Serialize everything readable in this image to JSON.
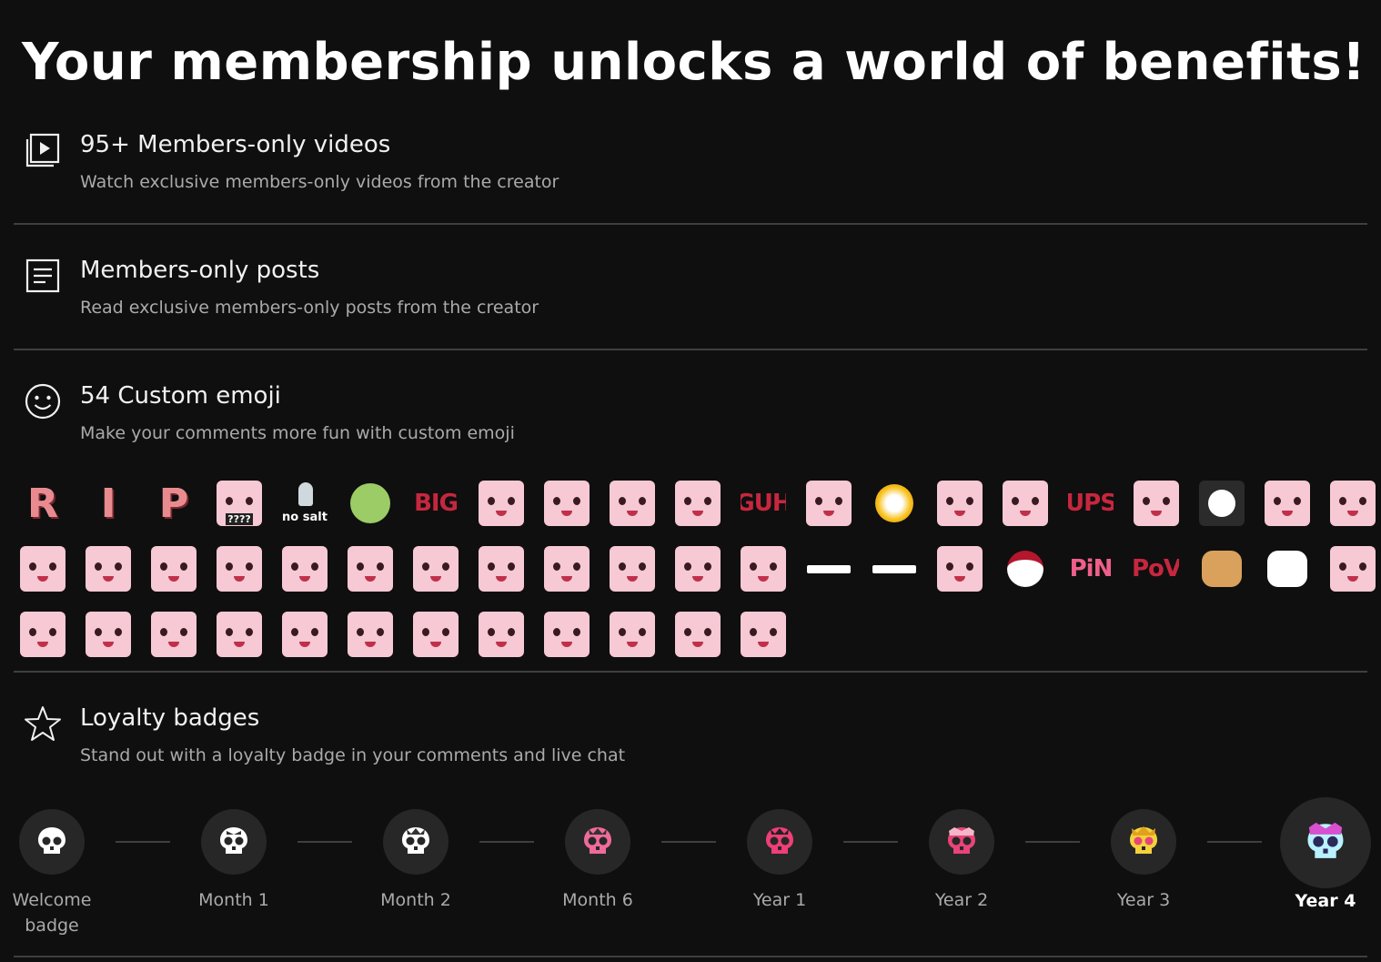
{
  "header": {
    "title": "Your membership unlocks a world of benefits!"
  },
  "perks": [
    {
      "icon": "video-library-icon",
      "title": "95+ Members-only videos",
      "description": "Watch exclusive members-only videos from the creator"
    },
    {
      "icon": "posts-icon",
      "title": "Members-only posts",
      "description": "Read exclusive members-only posts from the creator"
    },
    {
      "icon": "smiley-icon",
      "title": "54 Custom emoji",
      "description": "Make your comments more fun with custom emoji"
    },
    {
      "icon": "star-icon",
      "title": "Loyalty badges",
      "description": "Stand out with a loyalty badge in your comments and live chat"
    }
  ],
  "emoji": {
    "count": 54,
    "text_labels": {
      "r": "R",
      "i": "I",
      "p": "P",
      "big": "BIG",
      "guh": "GUH",
      "ups": "UPS",
      "pin": "PiN",
      "pov": "PoV",
      "nosalt": "no salt",
      "qmarks": "????"
    }
  },
  "badges": [
    {
      "label": "Welcome badge",
      "selected": false,
      "color": "#ffffff"
    },
    {
      "label": "Month 1",
      "selected": false,
      "color": "#ffffff"
    },
    {
      "label": "Month 2",
      "selected": false,
      "color": "#ffffff"
    },
    {
      "label": "Month 6",
      "selected": false,
      "color": "#ee6b9a"
    },
    {
      "label": "Year 1",
      "selected": false,
      "color": "#ee3f78"
    },
    {
      "label": "Year 2",
      "selected": false,
      "color": "#e8447a"
    },
    {
      "label": "Year 3",
      "selected": false,
      "color": "#f4d23c"
    },
    {
      "label": "Year 4",
      "selected": true,
      "color": "#b9f2ff"
    }
  ]
}
